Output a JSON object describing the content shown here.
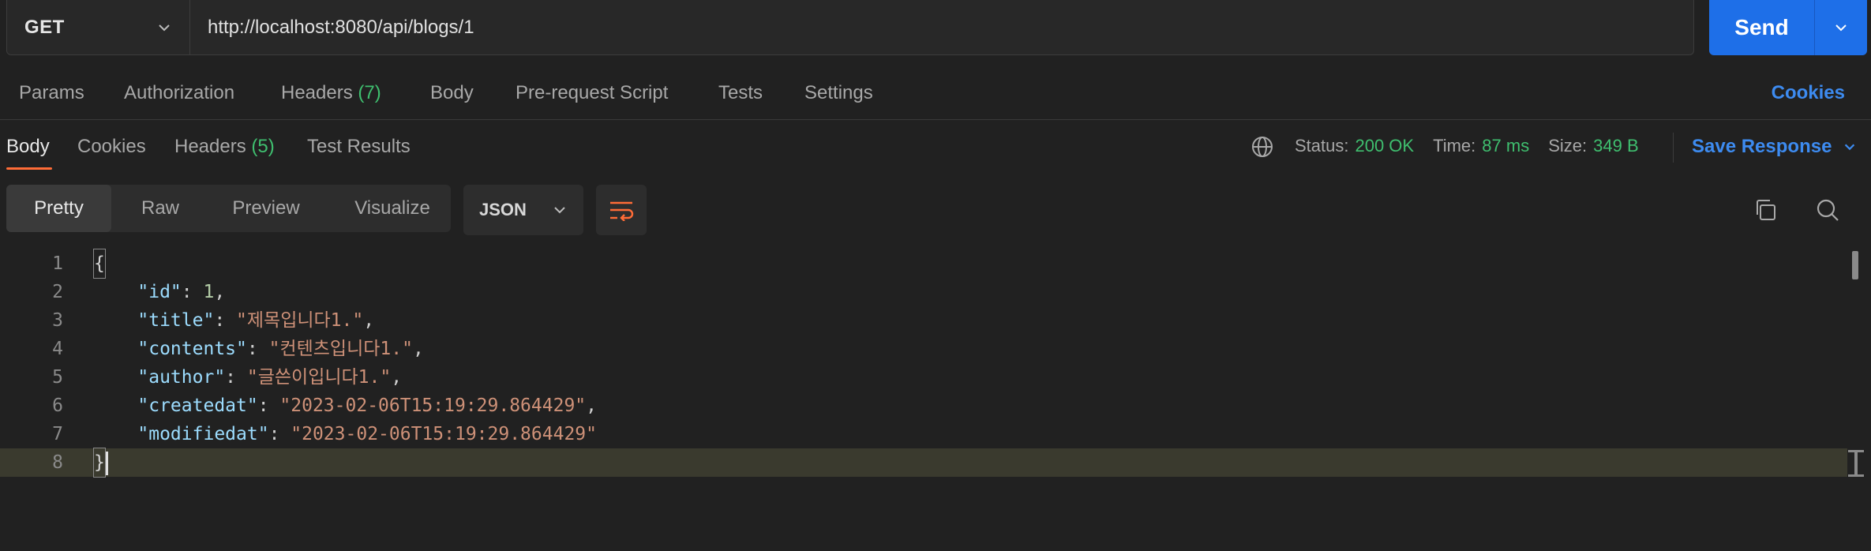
{
  "request": {
    "method": "GET",
    "url": "http://localhost:8080/api/blogs/1",
    "send_label": "Send"
  },
  "request_tabs": {
    "params": "Params",
    "authorization": "Authorization",
    "headers": "Headers",
    "headers_count": "(7)",
    "body": "Body",
    "pre_request": "Pre-request Script",
    "tests": "Tests",
    "settings": "Settings",
    "cookies": "Cookies"
  },
  "response_tabs": {
    "body": "Body",
    "cookies": "Cookies",
    "headers": "Headers",
    "headers_count": "(5)",
    "test_results": "Test Results"
  },
  "response_meta": {
    "status_label": "Status:",
    "status_value": "200 OK",
    "time_label": "Time:",
    "time_value": "87 ms",
    "size_label": "Size:",
    "size_value": "349 B",
    "save_response": "Save Response"
  },
  "view_modes": {
    "pretty": "Pretty",
    "raw": "Raw",
    "preview": "Preview",
    "visualize": "Visualize",
    "format": "JSON"
  },
  "response_body": {
    "line_numbers": [
      "1",
      "2",
      "3",
      "4",
      "5",
      "6",
      "7",
      "8"
    ],
    "open_brace": "{",
    "close_brace": "}",
    "fields": [
      {
        "key": "\"id\"",
        "value": "1",
        "type": "number"
      },
      {
        "key": "\"title\"",
        "value": "\"제목입니다1.\"",
        "type": "string"
      },
      {
        "key": "\"contents\"",
        "value": "\"컨텐츠입니다1.\"",
        "type": "string"
      },
      {
        "key": "\"author\"",
        "value": "\"글쓴이입니다1.\"",
        "type": "string"
      },
      {
        "key": "\"createdat\"",
        "value": "\"2023-02-06T15:19:29.864429\"",
        "type": "string"
      },
      {
        "key": "\"modifiedat\"",
        "value": "\"2023-02-06T15:19:29.864429\"",
        "type": "string"
      }
    ]
  },
  "colors": {
    "accent_orange": "#ff6c37",
    "link_blue": "#3d8bf0",
    "send_blue": "#1e6fe8",
    "success_green": "#3fbf6f"
  }
}
